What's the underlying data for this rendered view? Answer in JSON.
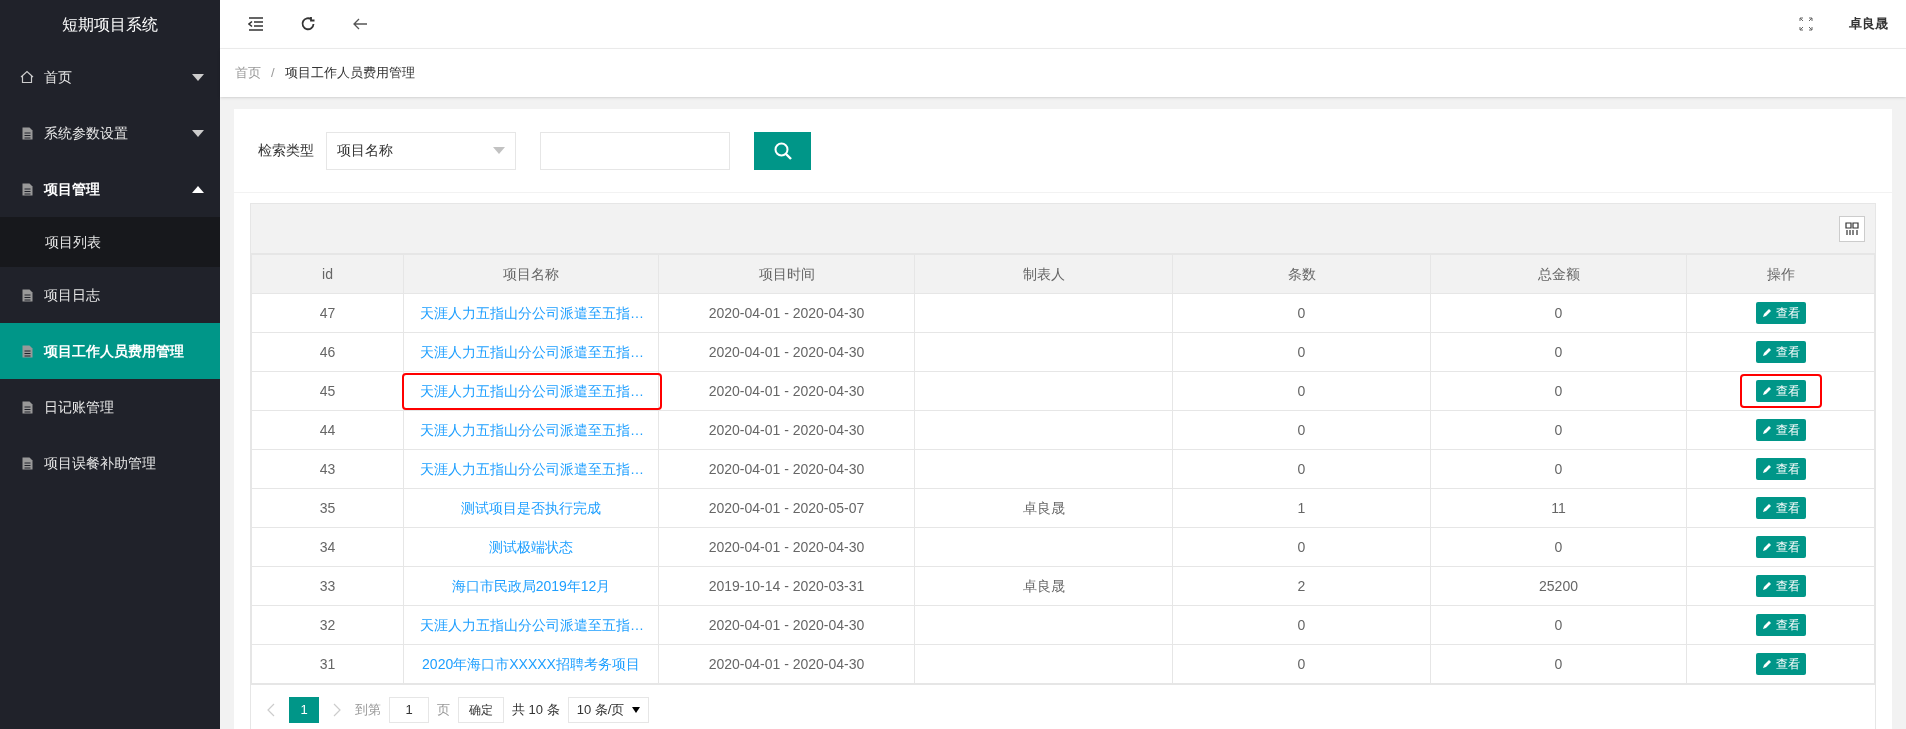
{
  "sidebar": {
    "title": "短期项目系统",
    "items": [
      {
        "label": "首页",
        "expanded": false,
        "selected": false
      },
      {
        "label": "系统参数设置",
        "expanded": false,
        "selected": false
      },
      {
        "label": "项目管理",
        "expanded": true,
        "selected": false,
        "children": [
          {
            "label": "项目列表",
            "selected": false
          }
        ]
      },
      {
        "label": "项目日志",
        "selected": false
      },
      {
        "label": "项目工作人员费用管理",
        "selected": true
      },
      {
        "label": "日记账管理",
        "selected": false
      },
      {
        "label": "项目误餐补助管理",
        "selected": false
      }
    ]
  },
  "header": {
    "user": "卓良晟"
  },
  "breadcrumb": {
    "separator": "/",
    "items": [
      "首页",
      "项目工作人员费用管理"
    ]
  },
  "search": {
    "label": "检索类型",
    "type_value": "项目名称"
  },
  "table": {
    "columns": [
      "id",
      "项目名称",
      "项目时间",
      "制表人",
      "条数",
      "总金额",
      "操作"
    ],
    "rows": [
      {
        "id": "47",
        "name": "天涯人力五指山分公司派遣至五指…",
        "time": "2020-04-01 - 2020-04-30",
        "author": "",
        "count": "0",
        "total": "0",
        "action": "查看",
        "highlighted": false
      },
      {
        "id": "46",
        "name": "天涯人力五指山分公司派遣至五指…",
        "time": "2020-04-01 - 2020-04-30",
        "author": "",
        "count": "0",
        "total": "0",
        "action": "查看",
        "highlighted": false
      },
      {
        "id": "45",
        "name": "天涯人力五指山分公司派遣至五指…",
        "time": "2020-04-01 - 2020-04-30",
        "author": "",
        "count": "0",
        "total": "0",
        "action": "查看",
        "highlighted": true
      },
      {
        "id": "44",
        "name": "天涯人力五指山分公司派遣至五指…",
        "time": "2020-04-01 - 2020-04-30",
        "author": "",
        "count": "0",
        "total": "0",
        "action": "查看",
        "highlighted": false
      },
      {
        "id": "43",
        "name": "天涯人力五指山分公司派遣至五指…",
        "time": "2020-04-01 - 2020-04-30",
        "author": "",
        "count": "0",
        "total": "0",
        "action": "查看",
        "highlighted": false
      },
      {
        "id": "35",
        "name": "测试项目是否执行完成",
        "time": "2020-04-01 - 2020-05-07",
        "author": "卓良晟",
        "count": "1",
        "total": "11",
        "action": "查看",
        "highlighted": false
      },
      {
        "id": "34",
        "name": "测试极端状态",
        "time": "2020-04-01 - 2020-04-30",
        "author": "",
        "count": "0",
        "total": "0",
        "action": "查看",
        "highlighted": false
      },
      {
        "id": "33",
        "name": "海口市民政局2019年12月",
        "time": "2019-10-14 - 2020-03-31",
        "author": "卓良晟",
        "count": "2",
        "total": "25200",
        "action": "查看",
        "highlighted": false
      },
      {
        "id": "32",
        "name": "天涯人力五指山分公司派遣至五指…",
        "time": "2020-04-01 - 2020-04-30",
        "author": "",
        "count": "0",
        "total": "0",
        "action": "查看",
        "highlighted": false
      },
      {
        "id": "31",
        "name": "2020年海口市XXXXX招聘考务项目",
        "time": "2020-04-01 - 2020-04-30",
        "author": "",
        "count": "0",
        "total": "0",
        "action": "查看",
        "highlighted": false
      }
    ]
  },
  "pagination": {
    "pages": [
      {
        "label": "1",
        "selected": true
      }
    ],
    "goto_label": "到第",
    "goto_value": "1",
    "page_unit": "页",
    "confirm": "确定",
    "total": "共 10 条",
    "page_size": "10 条/页"
  }
}
